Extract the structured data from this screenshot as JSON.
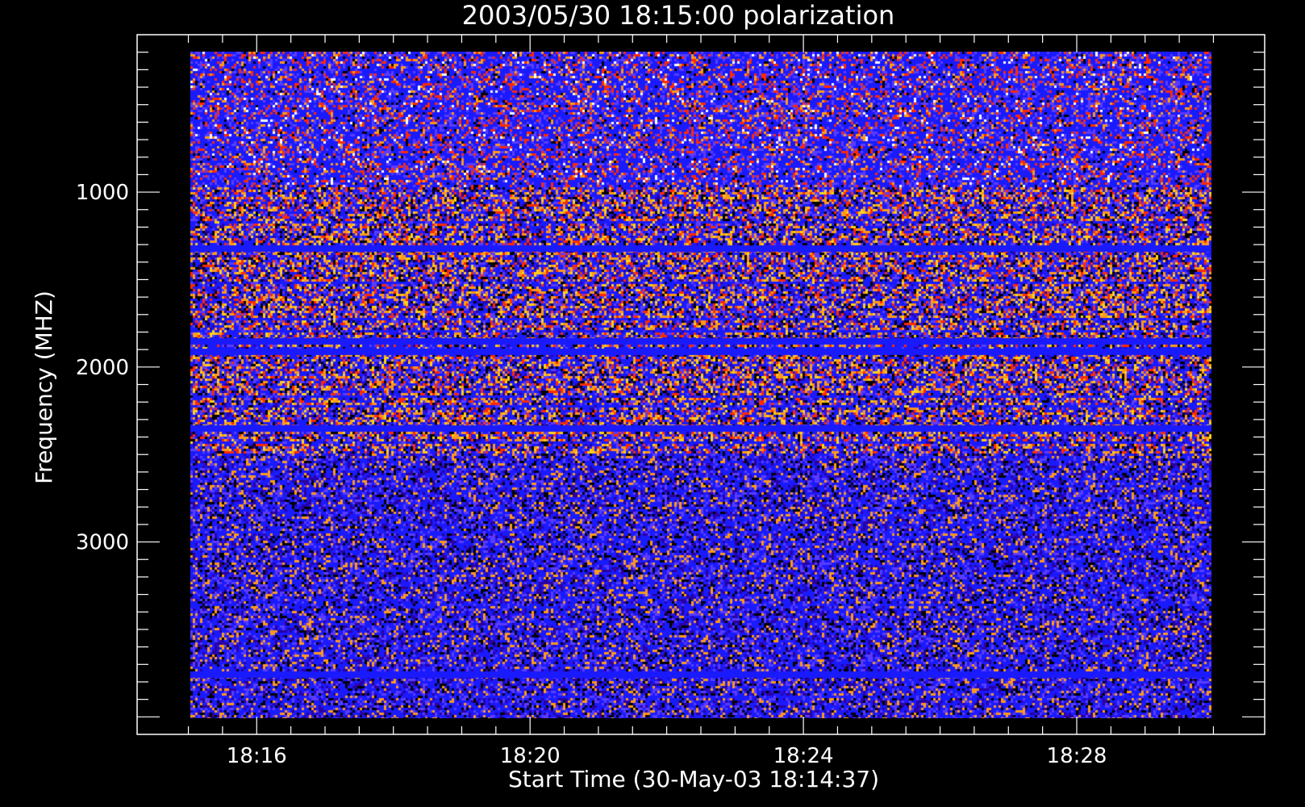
{
  "chart_data": {
    "type": "heatmap",
    "title": "2003/05/30 18:15:00 polarization",
    "xlabel": "Start Time (30-May-03 18:14:37)",
    "ylabel": "Frequency (MHZ)",
    "x_ticks": [
      {
        "label": "18:16",
        "minutes": 16
      },
      {
        "label": "18:20",
        "minutes": 20
      },
      {
        "label": "18:24",
        "minutes": 24
      },
      {
        "label": "18:28",
        "minutes": 28
      }
    ],
    "y_ticks": [
      {
        "label": "1000",
        "value": 1000
      },
      {
        "label": "2000",
        "value": 2000
      },
      {
        "label": "3000",
        "value": 3000
      }
    ],
    "x_range_minutes": [
      14.25,
      30.75
    ],
    "y_range_mhz": [
      100,
      4100
    ],
    "y_inverted": true,
    "colors": {
      "background": "#000000",
      "axes": "#ffffff",
      "dominant": "#1a1aff",
      "palette": [
        "#000000",
        "#2a00a0",
        "#1a1aff",
        "#5a3cff",
        "#ff2a00",
        "#ff9a1a",
        "#ffd21a",
        "#ffffff"
      ]
    }
  }
}
